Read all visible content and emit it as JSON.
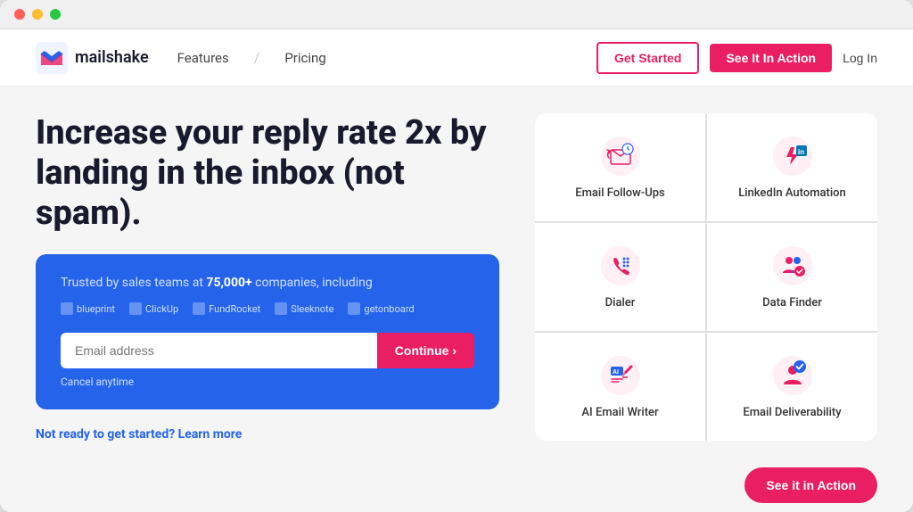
{
  "browser": {
    "dots": [
      "red",
      "yellow",
      "green"
    ]
  },
  "navbar": {
    "logo_text": "mailshake",
    "logo_tm": "™",
    "nav_features": "Features",
    "nav_slash": "/",
    "nav_pricing": "Pricing",
    "btn_get_started": "Get Started",
    "btn_see_action": "See It In Action",
    "btn_login": "Log In"
  },
  "hero": {
    "heading": "Increase your reply rate 2x by landing in the inbox (not spam)."
  },
  "cta_box": {
    "trusted_text_before": "Trusted by sales teams at ",
    "trusted_highlight": "75,000+",
    "trusted_text_after": " companies, including",
    "companies": [
      {
        "name": "blueprint",
        "icon": "🔷"
      },
      {
        "name": "ClickUp",
        "icon": "🔺"
      },
      {
        "name": "FundRocket",
        "icon": "🚀"
      },
      {
        "name": "Sleeknote",
        "icon": "📋"
      },
      {
        "name": "getonboard",
        "icon": "📌"
      }
    ],
    "email_placeholder": "Email address",
    "btn_continue": "Continue ›",
    "cancel_text": "Cancel anytime"
  },
  "features": [
    {
      "label": "Email Follow-Ups",
      "icon_name": "email-followup-icon",
      "icon_symbol": "↩"
    },
    {
      "label": "LinkedIn Automation",
      "icon_name": "linkedin-icon",
      "icon_symbol": "⚡"
    },
    {
      "label": "Dialer",
      "icon_name": "dialer-icon",
      "icon_symbol": "📞"
    },
    {
      "label": "Data Finder",
      "icon_name": "data-finder-icon",
      "icon_symbol": "👥"
    },
    {
      "label": "AI Email Writer",
      "icon_name": "ai-writer-icon",
      "icon_symbol": "✏️"
    },
    {
      "label": "Email Deliverability",
      "icon_name": "deliverability-icon",
      "icon_symbol": "✅"
    }
  ],
  "bottom": {
    "not_ready_text": "Not ready to get started? Learn more",
    "btn_see_action": "See it in Action"
  },
  "colors": {
    "primary_pink": "#e91e63",
    "primary_blue": "#2563eb",
    "nav_bg": "#ffffff",
    "feature_icon_color": "#e91e63"
  }
}
